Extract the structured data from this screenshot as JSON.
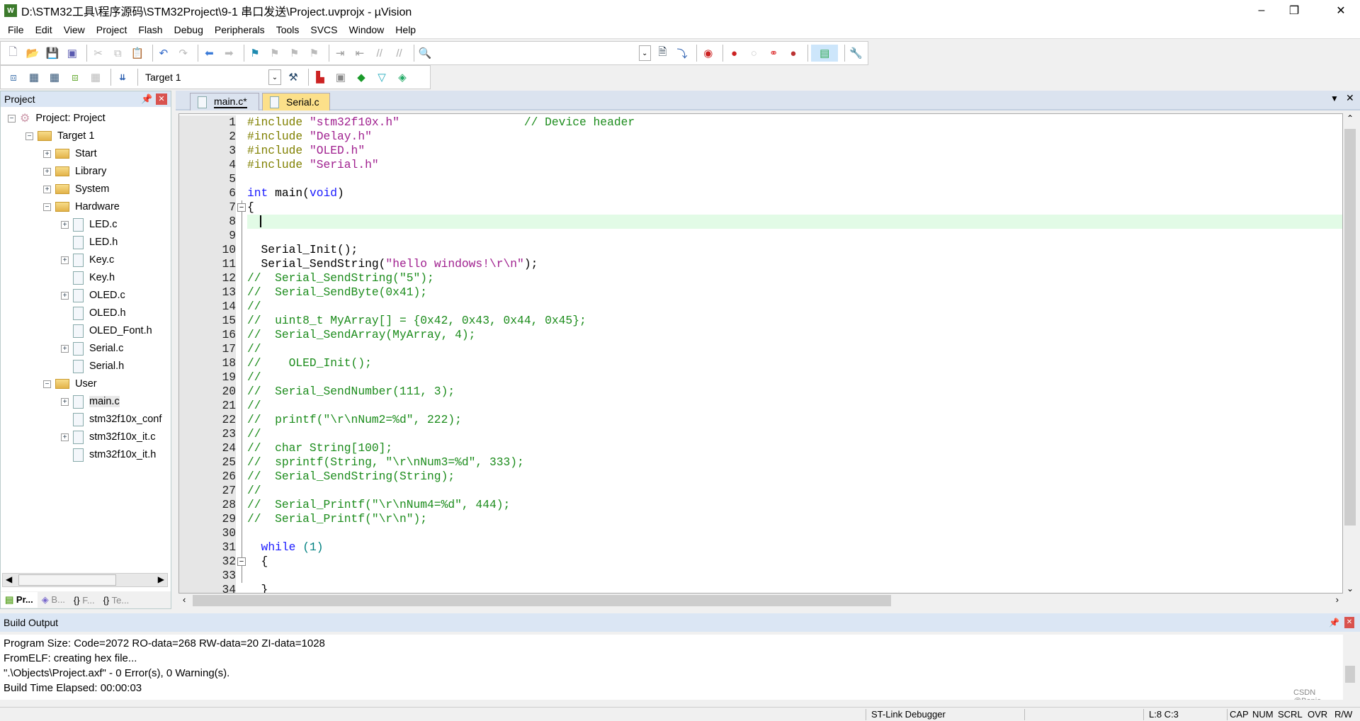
{
  "window": {
    "title": "D:\\STM32工具\\程序源码\\STM32Project\\9-1 串口发送\\Project.uvprojx - µVision",
    "logo": "W",
    "minimize": "–",
    "maximize": "❐",
    "close": "✕"
  },
  "menu": [
    "File",
    "Edit",
    "View",
    "Project",
    "Flash",
    "Debug",
    "Peripherals",
    "Tools",
    "SVCS",
    "Window",
    "Help"
  ],
  "toolbar2": {
    "target": "Target 1"
  },
  "project_panel": {
    "title": "Project",
    "tree": [
      {
        "label": "Project: Project",
        "level": 0,
        "kind": "root",
        "toggle": "−"
      },
      {
        "label": "Target 1",
        "level": 1,
        "kind": "target",
        "toggle": "−"
      },
      {
        "label": "Start",
        "level": 2,
        "kind": "folder",
        "toggle": "+"
      },
      {
        "label": "Library",
        "level": 2,
        "kind": "folder",
        "toggle": "+"
      },
      {
        "label": "System",
        "level": 2,
        "kind": "folder",
        "toggle": "+"
      },
      {
        "label": "Hardware",
        "level": 2,
        "kind": "folder",
        "toggle": "−"
      },
      {
        "label": "LED.c",
        "level": 3,
        "kind": "file",
        "toggle": "+"
      },
      {
        "label": "LED.h",
        "level": 3,
        "kind": "file",
        "toggle": ""
      },
      {
        "label": "Key.c",
        "level": 3,
        "kind": "file",
        "toggle": "+"
      },
      {
        "label": "Key.h",
        "level": 3,
        "kind": "file",
        "toggle": ""
      },
      {
        "label": "OLED.c",
        "level": 3,
        "kind": "file",
        "toggle": "+"
      },
      {
        "label": "OLED.h",
        "level": 3,
        "kind": "file",
        "toggle": ""
      },
      {
        "label": "OLED_Font.h",
        "level": 3,
        "kind": "file",
        "toggle": ""
      },
      {
        "label": "Serial.c",
        "level": 3,
        "kind": "file",
        "toggle": "+"
      },
      {
        "label": "Serial.h",
        "level": 3,
        "kind": "file",
        "toggle": ""
      },
      {
        "label": "User",
        "level": 2,
        "kind": "folder",
        "toggle": "−"
      },
      {
        "label": "main.c",
        "level": 3,
        "kind": "file",
        "toggle": "+",
        "selected": true
      },
      {
        "label": "stm32f10x_conf",
        "level": 3,
        "kind": "file",
        "toggle": ""
      },
      {
        "label": "stm32f10x_it.c",
        "level": 3,
        "kind": "file",
        "toggle": "+"
      },
      {
        "label": "stm32f10x_it.h",
        "level": 3,
        "kind": "file",
        "toggle": ""
      }
    ],
    "bottom_tabs": [
      "Pr...",
      "B...",
      "F...",
      "Te..."
    ]
  },
  "editor": {
    "tabs": [
      {
        "label": "main.c*",
        "active": true
      },
      {
        "label": "Serial.c",
        "active": false
      }
    ],
    "current_line": 8,
    "lines": [
      [
        [
          "pp",
          "#include "
        ],
        [
          "str",
          "\"stm32f10x.h\""
        ],
        [
          "pl",
          "                  "
        ],
        [
          "cm",
          "// Device header"
        ]
      ],
      [
        [
          "pp",
          "#include "
        ],
        [
          "str",
          "\"Delay.h\""
        ]
      ],
      [
        [
          "pp",
          "#include "
        ],
        [
          "str",
          "\"OLED.h\""
        ]
      ],
      [
        [
          "pp",
          "#include "
        ],
        [
          "str",
          "\"Serial.h\""
        ]
      ],
      [],
      [
        [
          "kw",
          "int"
        ],
        [
          "pl",
          " main("
        ],
        [
          "kw",
          "void"
        ],
        [
          "pl",
          ")"
        ]
      ],
      [
        [
          "pl",
          "{"
        ]
      ],
      [],
      [],
      [
        [
          "pl",
          "  Serial_Init();"
        ]
      ],
      [
        [
          "pl",
          "  Serial_SendString("
        ],
        [
          "str",
          "\"hello windows!\\r\\n\""
        ],
        [
          "pl",
          ");"
        ]
      ],
      [
        [
          "cm",
          "//  Serial_SendString(\"5\");"
        ]
      ],
      [
        [
          "cm",
          "//  Serial_SendByte(0x41);"
        ]
      ],
      [
        [
          "cm",
          "//"
        ]
      ],
      [
        [
          "cm",
          "//  uint8_t MyArray[] = {0x42, 0x43, 0x44, 0x45};"
        ]
      ],
      [
        [
          "cm",
          "//  Serial_SendArray(MyArray, 4);"
        ]
      ],
      [
        [
          "cm",
          "//"
        ]
      ],
      [
        [
          "cm",
          "//    OLED_Init();"
        ]
      ],
      [
        [
          "cm",
          "//"
        ]
      ],
      [
        [
          "cm",
          "//  Serial_SendNumber(111, 3);"
        ]
      ],
      [
        [
          "cm",
          "//"
        ]
      ],
      [
        [
          "cm",
          "//  printf(\"\\r\\nNum2=%d\", 222);"
        ]
      ],
      [
        [
          "cm",
          "//"
        ]
      ],
      [
        [
          "cm",
          "//  char String[100];"
        ]
      ],
      [
        [
          "cm",
          "//  sprintf(String, \"\\r\\nNum3=%d\", 333);"
        ]
      ],
      [
        [
          "cm",
          "//  Serial_SendString(String);"
        ]
      ],
      [
        [
          "cm",
          "//"
        ]
      ],
      [
        [
          "cm",
          "//  Serial_Printf(\"\\r\\nNum4=%d\", 444);"
        ]
      ],
      [
        [
          "cm",
          "//  Serial_Printf(\"\\r\\n\");"
        ]
      ],
      [],
      [
        [
          "pl",
          "  "
        ],
        [
          "kw",
          "while"
        ],
        [
          "pl",
          " "
        ],
        [
          "num",
          "(1)"
        ]
      ],
      [
        [
          "pl",
          "  {"
        ]
      ],
      [],
      [
        [
          "pl",
          "  }"
        ]
      ]
    ],
    "fold_lines": [
      7,
      32
    ]
  },
  "build_output": {
    "title": "Build Output",
    "lines": [
      "Program Size: Code=2072 RO-data=268 RW-data=20 ZI-data=1028",
      "FromELF: creating hex file...",
      "\".\\Objects\\Project.axf\" - 0 Error(s), 0 Warning(s).",
      "Build Time Elapsed:  00:00:03"
    ]
  },
  "status": {
    "debugger": "ST-Link Debugger",
    "position": "L:8 C:3",
    "cap": "CAP",
    "num": "NUM",
    "scrl": "SCRL",
    "ovr": "OVR",
    "rw": "R/W"
  },
  "watermark": "CSDN @Bopie",
  "colors": {
    "comment": "#1c8c1c",
    "string": "#a0208f",
    "preprocessor": "#808000",
    "keyword": "#1a1aff",
    "current_line": "#e2fbe6",
    "panel_header": "#dbe6f4",
    "close_red": "#d9534f"
  }
}
